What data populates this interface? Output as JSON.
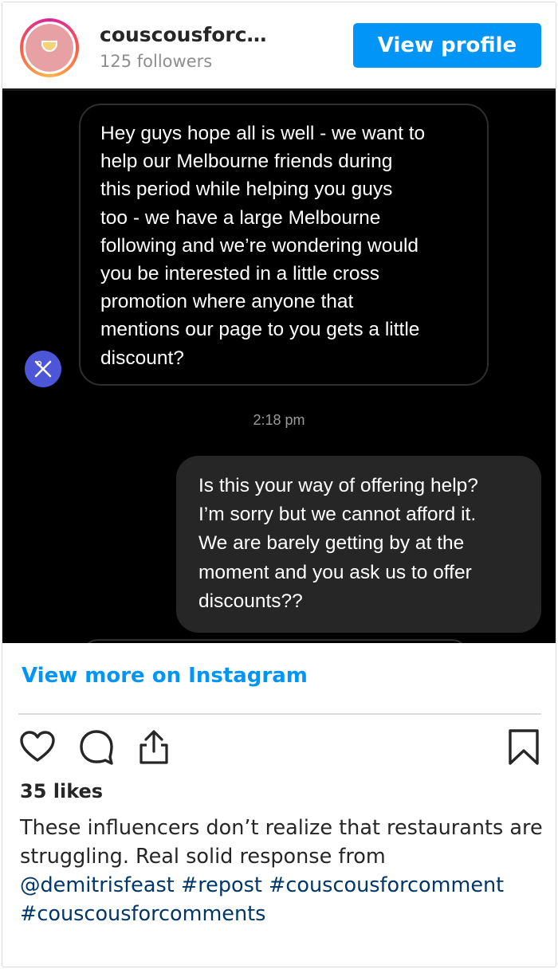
{
  "header": {
    "username": "couscousforc…",
    "followers": "125 followers",
    "view_profile_label": "View profile"
  },
  "conversation": {
    "incoming_lines": [
      "Hey guys hope all is well - we want to",
      "help our Melbourne friends during",
      "this period while helping you guys",
      "too - we have a large Melbourne",
      "following and we’re wondering would",
      "you be interested in a little cross",
      "promotion where anyone that",
      "mentions our page to you gets a little",
      "discount?"
    ],
    "timestamp": "2:18 pm",
    "outgoing_lines": [
      "Is this your way of offering help?",
      "I’m sorry but we cannot afford it.",
      "We are barely getting by at the",
      "moment and you ask us to offer",
      "discounts??"
    ]
  },
  "footer": {
    "view_more_label": "View more on Instagram",
    "likes": "35 likes",
    "caption_text": "These influencers don’t realize that restaurants are struggling. Real solid response from",
    "mention": "@demitrisfeast",
    "hashtags": [
      "#repost",
      "#couscousforcomment",
      "#couscousforcomments"
    ]
  },
  "icons": {
    "like": "heart-icon",
    "comment": "comment-icon",
    "share": "share-icon",
    "save": "bookmark-icon"
  },
  "colors": {
    "accent": "#0095f6",
    "link": "#00376b",
    "sender_avatar": "#4c56d6"
  }
}
